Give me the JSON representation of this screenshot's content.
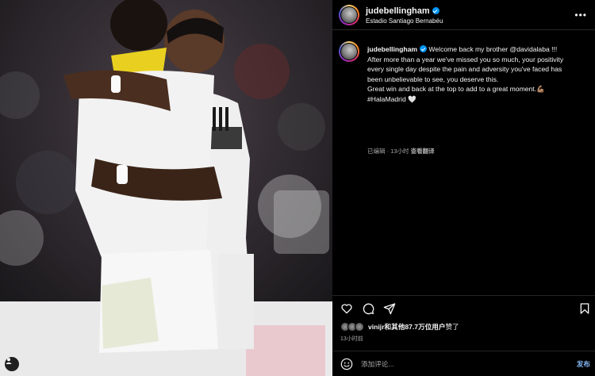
{
  "post": {
    "username": "judebellingham",
    "location": "Estadio Santiago Bernabéu",
    "more_label": "•••"
  },
  "caption": {
    "username": "judebellingham",
    "lines": [
      "Welcome back my brother @davidalaba !!!",
      "After more than a year we've missed you so much, your positivity",
      "every single day despite the pain and adversity you've faced has",
      "been unbelievable to see, you deserve this.",
      "Great win and back at the top to add to a great moment.💪🏽",
      "#HalaMadrid 🤍"
    ],
    "meta_time": "已编辑 · 13小时",
    "translate_label": "查看翻译"
  },
  "likes": {
    "user": "vinijr",
    "text_middle": "和",
    "others": "其他87.7万位用户",
    "text_end": "赞了"
  },
  "time_ago": "13小时前",
  "comment": {
    "placeholder": "添加评论...",
    "post_label": "发布"
  },
  "colors": {
    "background": "#000000",
    "verified": "#0095f6",
    "post_button": "#85b7f5",
    "meta": "#a8a8a8"
  },
  "icons": [
    "heart-icon",
    "comment-icon",
    "share-icon",
    "bookmark-icon",
    "emoji-icon",
    "more-icon",
    "user-tag-icon",
    "verified-icon"
  ]
}
